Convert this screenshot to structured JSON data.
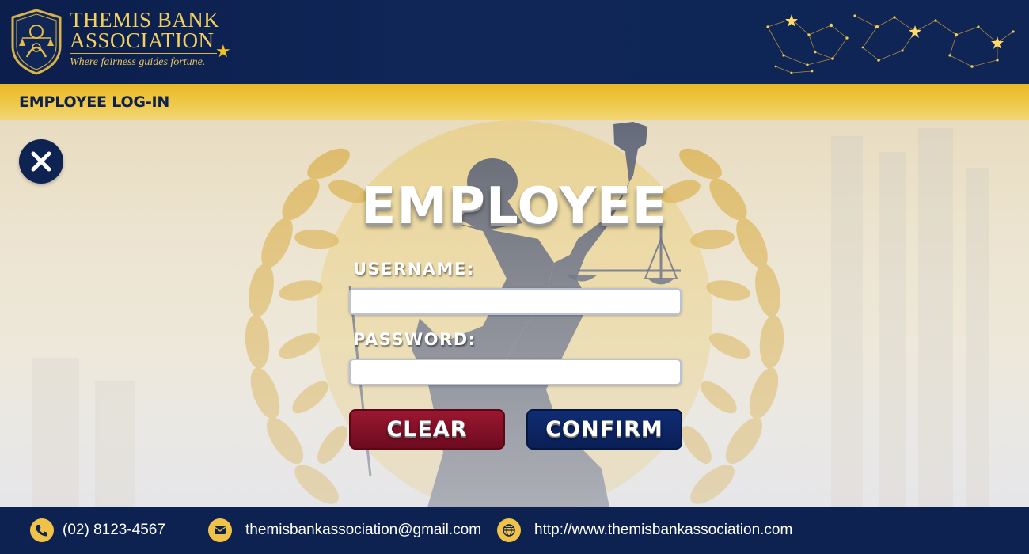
{
  "header": {
    "brand_line1": "THEMIS BANK",
    "brand_line2": "ASSOCIATION",
    "tagline": "Where fairness guides fortune."
  },
  "title_strip": {
    "label": "EMPLOYEE LOG-IN"
  },
  "form": {
    "title": "EMPLOYEE",
    "username_label": "USERNAME:",
    "username_value": "",
    "password_label": "PASSWORD:",
    "password_value": "",
    "clear_label": "CLEAR",
    "confirm_label": "CONFIRM"
  },
  "footer": {
    "phone": "(02) 8123-4567",
    "email": "themisbankassociation@gmail.com",
    "website": "http://www.themisbankassociation.com"
  },
  "icons": {
    "close": "close-icon",
    "phone": "phone-icon",
    "email": "mail-icon",
    "website": "globe-icon"
  },
  "colors": {
    "navy": "#0d2251",
    "gold": "#f0c348",
    "clear_button": "#7e0f25",
    "confirm_button": "#0c2362"
  }
}
